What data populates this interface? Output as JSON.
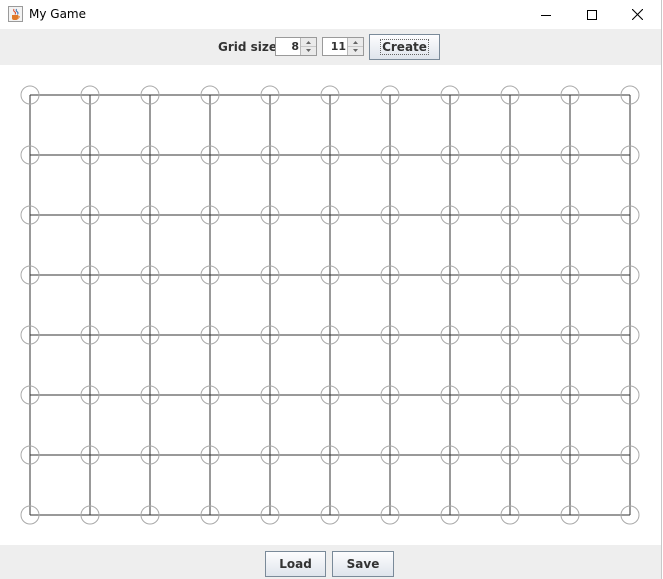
{
  "window": {
    "title": "My Game",
    "icon": "java-coffee-cup-icon",
    "controls": [
      "minimize-icon",
      "maximize-icon",
      "close-icon"
    ]
  },
  "toolbar": {
    "grid_size_label": "Grid size:",
    "rows_value": "8",
    "cols_value": "11",
    "create_label": "Create"
  },
  "board": {
    "rows": 8,
    "cols": 11,
    "line_color": "#333333",
    "node_circle_color": "#aaaaaa"
  },
  "footer": {
    "load_label": "Load",
    "save_label": "Save"
  }
}
